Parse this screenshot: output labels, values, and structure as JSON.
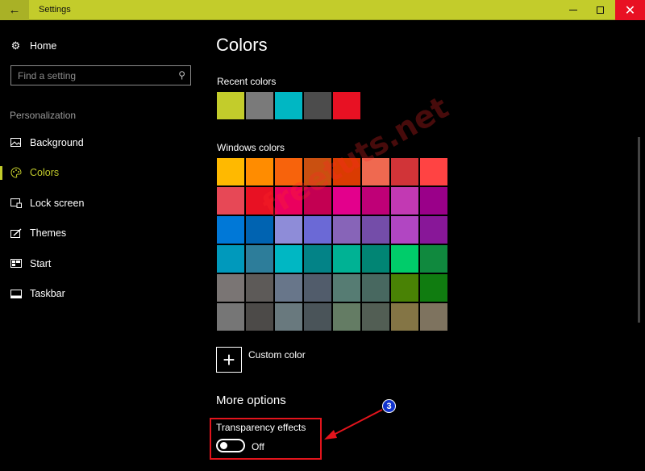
{
  "window": {
    "title": "Settings",
    "back_icon": "back-arrow-icon",
    "minimize_icon": "minimize-icon",
    "maximize_icon": "maximize-icon",
    "close_icon": "close-icon",
    "accent_color": "#c3cc2b"
  },
  "sidebar": {
    "home_label": "Home",
    "home_icon": "gear-icon",
    "search": {
      "placeholder": "Find a setting",
      "value": "",
      "icon": "search-icon"
    },
    "section_label": "Personalization",
    "items": [
      {
        "label": "Background",
        "icon": "image-icon",
        "active": false
      },
      {
        "label": "Colors",
        "icon": "palette-icon",
        "active": true
      },
      {
        "label": "Lock screen",
        "icon": "lock-screen-icon",
        "active": false
      },
      {
        "label": "Themes",
        "icon": "themes-icon",
        "active": false
      },
      {
        "label": "Start",
        "icon": "start-icon",
        "active": false
      },
      {
        "label": "Taskbar",
        "icon": "taskbar-icon",
        "active": false
      }
    ]
  },
  "main": {
    "title": "Colors",
    "recent_label": "Recent colors",
    "recent_colors": [
      "#c3cc2b",
      "#7a7a7a",
      "#00b7c3",
      "#4c4c4c",
      "#e81123"
    ],
    "windows_label": "Windows colors",
    "windows_colors": [
      [
        "#ffb900",
        "#ff8c00",
        "#f7630c",
        "#ca5010",
        "#da3b01",
        "#ef6950",
        "#d13438",
        "#ff4343"
      ],
      [
        "#e74856",
        "#e81123",
        "#ea005e",
        "#c30052",
        "#e3008c",
        "#bf0077",
        "#c239b3",
        "#9a0089"
      ],
      [
        "#0078d7",
        "#0063b1",
        "#8e8cd8",
        "#6b69d6",
        "#8764b8",
        "#744da9",
        "#b146c2",
        "#881798"
      ],
      [
        "#0099bc",
        "#2d7d9a",
        "#00b7c3",
        "#038387",
        "#00b294",
        "#018574",
        "#00cc6a",
        "#10893e"
      ],
      [
        "#7a7574",
        "#5d5a58",
        "#68768a",
        "#515c6b",
        "#567c73",
        "#486860",
        "#498205",
        "#107c10"
      ],
      [
        "#767676",
        "#4c4a48",
        "#69797e",
        "#4a5459",
        "#647c64",
        "#525e54",
        "#847545",
        "#7e735f"
      ]
    ],
    "custom_color_label": "Custom color",
    "custom_color_icon": "plus-icon",
    "more_options_title": "More options",
    "transparency_label": "Transparency effects",
    "transparency_state": "Off"
  },
  "annotation": {
    "step_number": "3",
    "highlight_color": "#e3141c"
  },
  "watermark": "freetuts.net"
}
